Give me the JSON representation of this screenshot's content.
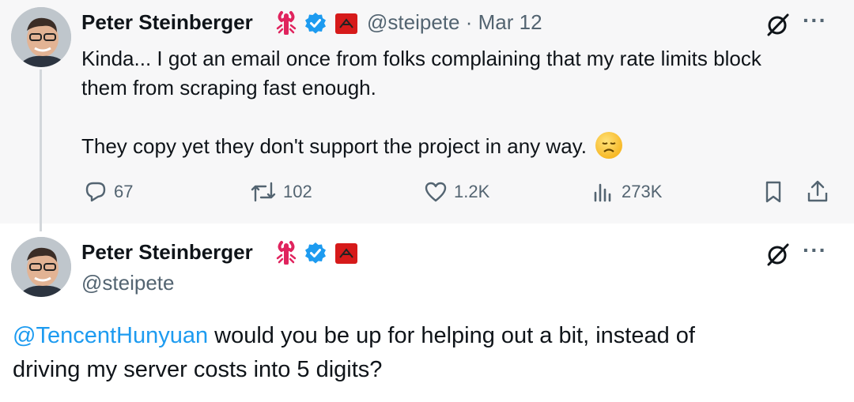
{
  "post1": {
    "author_name": "Peter Steinberger",
    "handle": "@steipete",
    "separator": "·",
    "date": "Mar 12",
    "text_line1": "Kinda... I got an email once from folks complaining that my rate limits block",
    "text_line2": "them from scraping fast enough.",
    "text_line3": "They copy yet they don't support the project in any way.",
    "emoji": "disappointed-face",
    "actions": {
      "replies": "67",
      "reposts": "102",
      "likes": "1.2K",
      "views": "273K"
    }
  },
  "post2": {
    "author_name": "Peter Steinberger",
    "handle": "@steipete",
    "mention": "@TencentHunyuan",
    "text_after_mention": " would you be up for helping out a bit, instead of",
    "text_line2": "driving my server costs into 5 digits?"
  },
  "colors": {
    "accent": "#1d9bf0",
    "muted": "#536471",
    "text": "#0f1419",
    "verified": "#1d9bf0",
    "lobster": "#e0245e"
  },
  "icons": [
    "lobster-icon",
    "verified-badge-icon",
    "flag-badge-icon",
    "grok-icon",
    "more-icon",
    "reply-icon",
    "repost-icon",
    "like-icon",
    "views-icon",
    "bookmark-icon",
    "share-icon"
  ]
}
